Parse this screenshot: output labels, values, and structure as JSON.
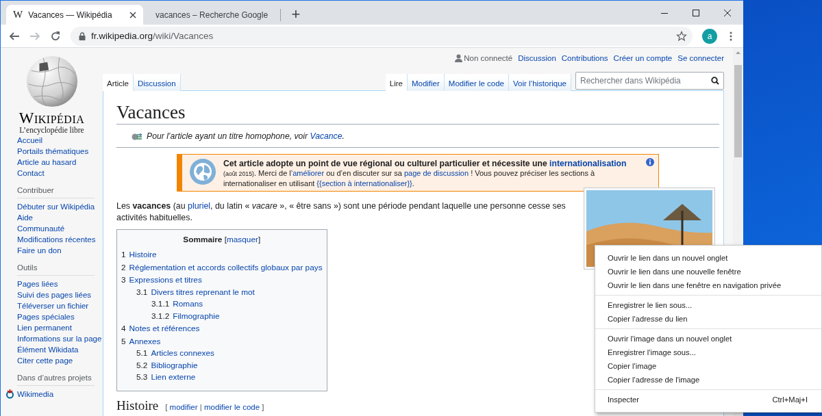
{
  "browser": {
    "tabs": [
      {
        "title": "Vacances — Wikipédia",
        "favicon": "W",
        "selected": true
      },
      {
        "title": "vacances – Recherche Google",
        "selected": false
      }
    ],
    "new_tab": "+",
    "nav": [
      {
        "kind": "back",
        "disabled": false
      },
      {
        "kind": "forward",
        "disabled": true
      },
      {
        "kind": "reload",
        "disabled": false
      }
    ],
    "address": {
      "host": "fr.wikipedia.org",
      "path": "/wiki/Vacances"
    },
    "profile": "a"
  },
  "personal_tools": [
    {
      "label": "Non connecté",
      "kind": "status"
    },
    {
      "label": "Discussion",
      "kind": "link"
    },
    {
      "label": "Contributions",
      "kind": "link"
    },
    {
      "label": "Créer un compte",
      "kind": "link"
    },
    {
      "label": "Se connecter",
      "kind": "link"
    }
  ],
  "logo": {
    "wordmark": "Wikipédia",
    "tagline": "L’encyclopédie libre"
  },
  "sidebar": [
    {
      "kind": "nav",
      "items": [
        "Accueil",
        "Portails thématiques",
        "Article au hasard",
        "Contact"
      ]
    },
    {
      "kind": "nav",
      "heading": "Contribuer",
      "items": [
        "Débuter sur Wikipédia",
        "Aide",
        "Communauté",
        "Modifications récentes",
        "Faire un don"
      ]
    },
    {
      "kind": "nav",
      "heading": "Outils",
      "items": [
        "Pages liées",
        "Suivi des pages liées",
        "Téléverser un fichier",
        "Pages spéciales",
        "Lien permanent",
        "Informations sur la page",
        "Élément Wikidata",
        "Citer cette page"
      ]
    },
    {
      "kind": "projects",
      "heading": "Dans d’autres projets",
      "items": [
        "Wikimedia"
      ]
    }
  ],
  "page_tabs": {
    "left": [
      {
        "label": "Article",
        "selected": true
      },
      {
        "label": "Discussion",
        "selected": false
      }
    ],
    "right": [
      {
        "label": "Lire",
        "selected": true
      },
      {
        "label": "Modifier",
        "selected": false
      },
      {
        "label": "Modifier le code",
        "selected": false
      },
      {
        "label": "Voir l’historique",
        "selected": false
      }
    ]
  },
  "search": {
    "placeholder": "Rechercher dans Wikipédia"
  },
  "article": {
    "title": "Vacances",
    "hatnote": [
      {
        "kind": "plain",
        "text": "Pour l’article ayant un titre homophone, voir "
      },
      {
        "kind": "link",
        "text": "Vacance"
      },
      {
        "kind": "plain",
        "text": "."
      }
    ],
    "banner": {
      "title": [
        {
          "kind": "plain",
          "text": "Cet article adopte un point de vue régional ou culturel particulier et nécessite une "
        },
        {
          "kind": "link",
          "text": "internationalisation"
        }
      ],
      "details": [
        {
          "kind": "small",
          "text": "(août 2015)"
        },
        {
          "kind": "plain",
          "text": ". Merci de l’"
        },
        {
          "kind": "link",
          "text": "améliorer"
        },
        {
          "kind": "plain",
          "text": " ou d’en discuter sur sa "
        },
        {
          "kind": "link",
          "text": "page de discussion"
        },
        {
          "kind": "plain",
          "text": " ! Vous pouvez préciser les sections à internationaliser en utilisant "
        },
        {
          "kind": "link",
          "text": "{{section à internationaliser}}"
        },
        {
          "kind": "plain",
          "text": "."
        }
      ]
    },
    "intro": [
      {
        "kind": "plain",
        "text": "Les "
      },
      {
        "kind": "bold",
        "text": "vacances"
      },
      {
        "kind": "plain",
        "text": " (au "
      },
      {
        "kind": "link",
        "text": "pluriel"
      },
      {
        "kind": "plain",
        "text": ", du latin « "
      },
      {
        "kind": "italic",
        "text": "vacare"
      },
      {
        "kind": "plain",
        "text": " », « être sans ») sont une période pendant laquelle une personne cesse ses activités habituelles."
      }
    ],
    "toc": {
      "heading": [
        {
          "kind": "bold",
          "text": "Sommaire"
        },
        {
          "kind": "plain",
          "text": " ["
        },
        {
          "kind": "link",
          "text": "masquer"
        },
        {
          "kind": "plain",
          "text": "]"
        }
      ],
      "entries": [
        {
          "number": "1",
          "label": "Histoire"
        },
        {
          "number": "2",
          "label": "Réglementation et accords collectifs globaux par pays"
        },
        {
          "number": "3",
          "label": "Expressions et titres",
          "children": [
            {
              "number": "3.1",
              "label": "Divers titres reprenant le mot",
              "children": [
                {
                  "number": "3.1.1",
                  "label": "Romans"
                },
                {
                  "number": "3.1.2",
                  "label": "Filmographie"
                }
              ]
            }
          ]
        },
        {
          "number": "4",
          "label": "Notes et références"
        },
        {
          "number": "5",
          "label": "Annexes",
          "children": [
            {
              "number": "5.1",
              "label": "Articles connexes"
            },
            {
              "number": "5.2",
              "label": "Bibliographie"
            },
            {
              "number": "5.3",
              "label": "Lien externe"
            }
          ]
        }
      ]
    },
    "sections": [
      {
        "title": "Histoire",
        "edit": [
          {
            "kind": "plain",
            "text": "[ "
          },
          {
            "kind": "link",
            "text": "modifier"
          },
          {
            "kind": "plain",
            "text": " | "
          },
          {
            "kind": "link",
            "text": "modifier le code"
          },
          {
            "kind": "plain",
            "text": " ]"
          }
        ]
      }
    ]
  },
  "context_menu": {
    "groups": [
      [
        {
          "label": "Ouvrir le lien dans un nouvel onglet"
        },
        {
          "label": "Ouvrir le lien dans une nouvelle fenêtre"
        },
        {
          "label": "Ouvrir le lien dans une fenêtre en navigation privée"
        }
      ],
      [
        {
          "label": "Enregistrer le lien sous..."
        },
        {
          "label": "Copier l'adresse du lien"
        }
      ],
      [
        {
          "label": "Ouvrir l'image dans un nouvel onglet"
        },
        {
          "label": "Enregistrer l'image sous..."
        },
        {
          "label": "Copier l'image"
        },
        {
          "label": "Copier l'adresse de l'image"
        }
      ],
      [
        {
          "label": "Inspecter",
          "shortcut": "Ctrl+Maj+I"
        }
      ]
    ]
  }
}
